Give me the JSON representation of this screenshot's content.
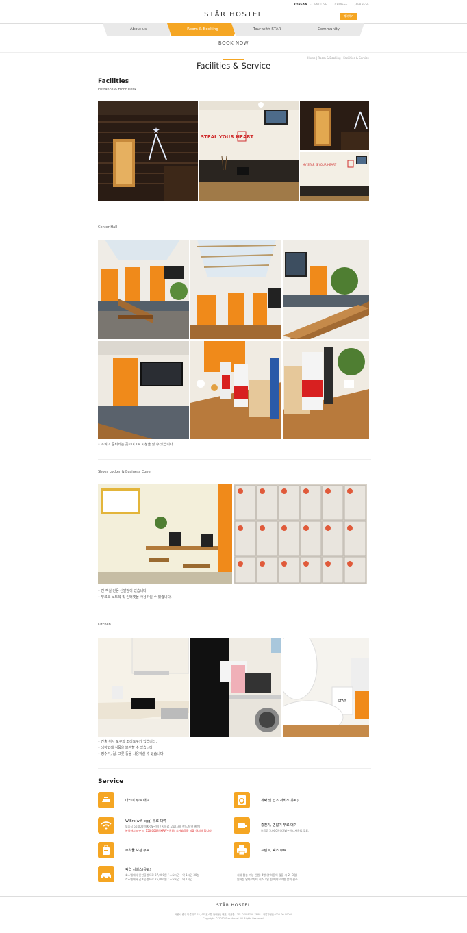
{
  "header": {
    "languages": [
      "KOREAN",
      "ENGLISH",
      "CHINESE",
      "JAPANESE"
    ],
    "logo": "STÅR HOSTEL",
    "reserve_label": "예약하기",
    "nav": [
      "About us",
      "Room & Booking",
      "Tour with STAR",
      "Community"
    ],
    "book_now": "BOOK NOW"
  },
  "breadcrumb": "Home  |  Room & Booking  |  Facilities & Service",
  "page_title": "Facilities & Service",
  "facilities": {
    "title": "Facilities",
    "entrance_label": "Entrance & Front Desk",
    "center_hall_label": "Center Hall",
    "center_hall_notes": [
      "• 조식이 준비되는 곳이며 TV 시청을 할 수 있습니다."
    ],
    "shoes_label": "Shoes Locker & Business Coner",
    "shoes_notes": [
      "• 전 객실 전용 신발장이 있습니다.",
      "• 무료로 노트북 및 인터넷을 사용하실 수 있습니다."
    ],
    "kitchen_label": "Kitchen",
    "kitchen_notes": [
      "• 간출 취사 도구와 조리도구가 있습니다.",
      "• 냉장고에 식품을 보관할 수 있습니다.",
      "• 정수기, 컵, 그릇 등을 사용하실 수 있습니다."
    ]
  },
  "service": {
    "title": "Service",
    "items": [
      {
        "icon": "iron-icon",
        "title": "다리미 무료 대여",
        "desc": []
      },
      {
        "icon": "washer-icon",
        "title": "세탁 및 건조 서비스(유료)",
        "desc": []
      },
      {
        "icon": "wifi-icon",
        "title": "WiBro(wifi egg) 무료 대여",
        "desc": [
          "보증금 50,000원(KRW~원) / 사용료 무료(사용 한도/제약 별수)"
        ],
        "desc_red": "분실하시 파손 시 150,000원(KRW~원)의 추가요금을 지불 하셔야 합니다."
      },
      {
        "icon": "battery-icon",
        "title": "충전기, 변압기 무료 대여",
        "desc": [
          "보증금 5,000원(KRW~원), 사용료 무료."
        ]
      },
      {
        "icon": "luggage-icon",
        "title": "수하물 보관 무료",
        "desc": []
      },
      {
        "icon": "printer-icon",
        "title": "프린트, 팩스 무료.",
        "desc": []
      },
      {
        "icon": "taxi-icon",
        "title": "픽업 서비스(유료)",
        "desc": [
          "호스텔에서 인천공항으로 37,000원 / 소요시간 : 약 1시간 30분",
          "호스텔에서 김포공항으로 25,000원 / 소요시간 : 약 1시간"
        ]
      },
      {
        "icon": "",
        "title": "",
        "desc": [
          "최대 탑승 가능 인원: 4명 (수하물이 많을 시 2~3명)",
          "원하는 날짜로부터 최소 1일 전 예약으로만 문의 필수"
        ]
      }
    ]
  },
  "footer": {
    "logo": "STÅR HOSTEL",
    "address": "서울시 중구 마른내로 25, 스타호스텔 동대문   |   대표: 최근환   |   TEL 070-8729-7888   |   사업자번호: 000-00-00000",
    "copyright": "Copyright © 2012 Star Hostel. All Rights Reserved."
  },
  "colors": {
    "accent": "#f5a623",
    "text": "#333333"
  }
}
